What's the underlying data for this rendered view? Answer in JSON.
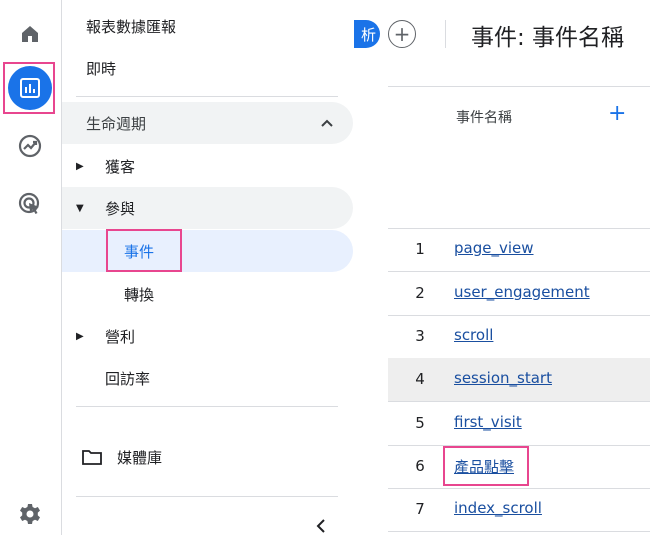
{
  "nav": {
    "reports_overview": "報表數據匯報",
    "realtime": "即時",
    "lifecycle": "生命週期",
    "acquisition": "獲客",
    "engagement": "參與",
    "events": "事件",
    "conversions": "轉換",
    "monetization": "營利",
    "retention": "回訪率",
    "library": "媒體庫"
  },
  "header": {
    "blue_chip": "析",
    "add": "+",
    "title": "事件: 事件名稱"
  },
  "table": {
    "column_header": "事件名稱",
    "add_column": "+",
    "rows": [
      {
        "rank": "1",
        "name": "page_view"
      },
      {
        "rank": "2",
        "name": "user_engagement"
      },
      {
        "rank": "3",
        "name": "scroll"
      },
      {
        "rank": "4",
        "name": "session_start"
      },
      {
        "rank": "5",
        "name": "first_visit"
      },
      {
        "rank": "6",
        "name": "產品點擊"
      },
      {
        "rank": "7",
        "name": "index_scroll"
      }
    ]
  },
  "colors": {
    "accent": "#1a73e8",
    "highlight": "#e8468f",
    "link": "#1a4fa0"
  }
}
